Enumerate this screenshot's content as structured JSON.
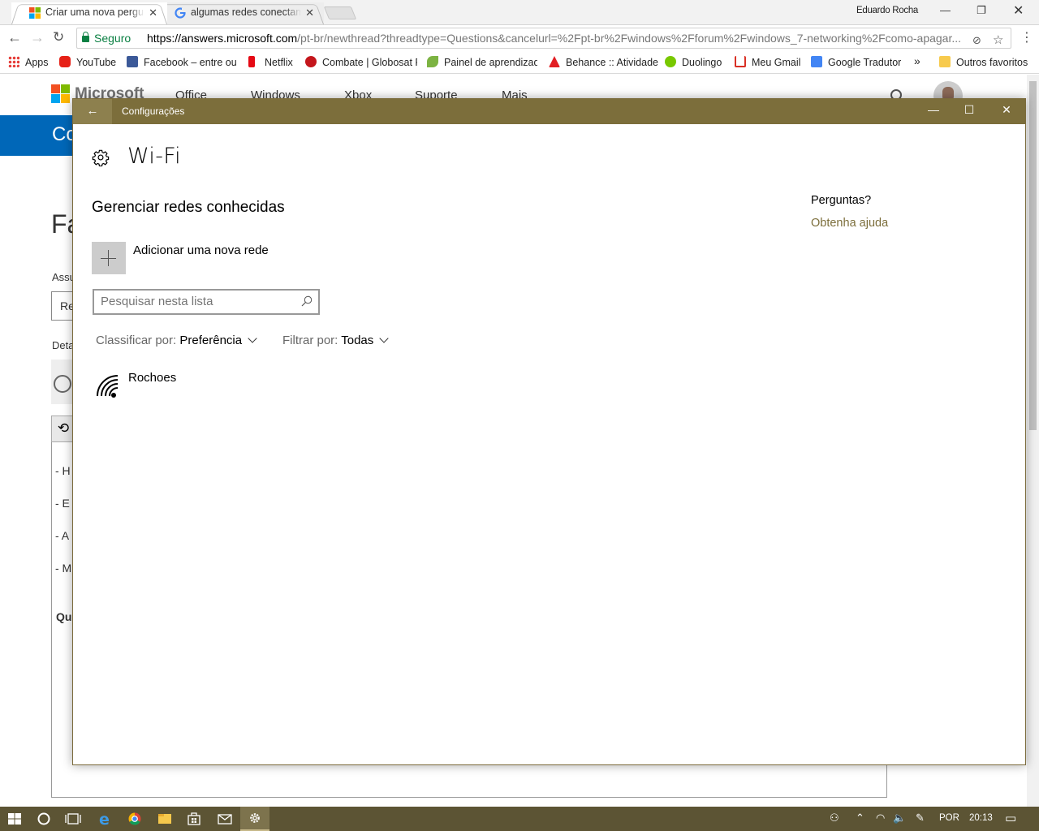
{
  "browser": {
    "tabs": [
      {
        "title": "Criar uma nova pergunta"
      },
      {
        "title": "algumas redes conectam"
      }
    ],
    "profile_name": "Eduardo Rocha",
    "secure_label": "Seguro",
    "url_host": "https://answers.microsoft.com",
    "url_path": "/pt-br/newthread?threadtype=Questions&cancelurl=%2Fpt-br%2Fwindows%2Fforum%2Fwindows_7-networking%2Fcomo-apagar..."
  },
  "bookmarks": {
    "apps": "Apps",
    "items": [
      "YouTube",
      "Facebook – entre ou",
      "Netflix",
      "Combate | Globosat F",
      "Painel de aprendizad",
      "Behance :: Atividade",
      "Duolingo",
      "Meu Gmail",
      "Google Tradutor"
    ],
    "more": "»",
    "other": "Outros favoritos"
  },
  "background_page": {
    "brand": "Microsoft",
    "nav": [
      "Office",
      "Windows",
      "Xbox",
      "Suporte",
      "Mais"
    ],
    "banner": "Co",
    "heading": "Fa",
    "label_subject": "Assu",
    "field_subject": "Re",
    "label_details": "Deta",
    "lines": [
      "- H",
      "- E",
      "- A",
      "- M"
    ],
    "bold_fragment": "Qu"
  },
  "settings": {
    "window_title": "Configurações",
    "page_title": "Wi-Fi",
    "section_title": "Gerenciar redes conhecidas",
    "add_network": "Adicionar uma nova rede",
    "search_placeholder": "Pesquisar nesta lista",
    "sort_label": "Classificar por:",
    "sort_value": "Preferência",
    "filter_label": "Filtrar por:",
    "filter_value": "Todas",
    "networks": [
      {
        "name": "Rochoes"
      }
    ],
    "help_question": "Perguntas?",
    "help_link": "Obtenha ajuda",
    "accent_color": "#7c6e3b"
  },
  "taskbar": {
    "language": "POR",
    "time": "20:13",
    "color": "#5c5434"
  }
}
